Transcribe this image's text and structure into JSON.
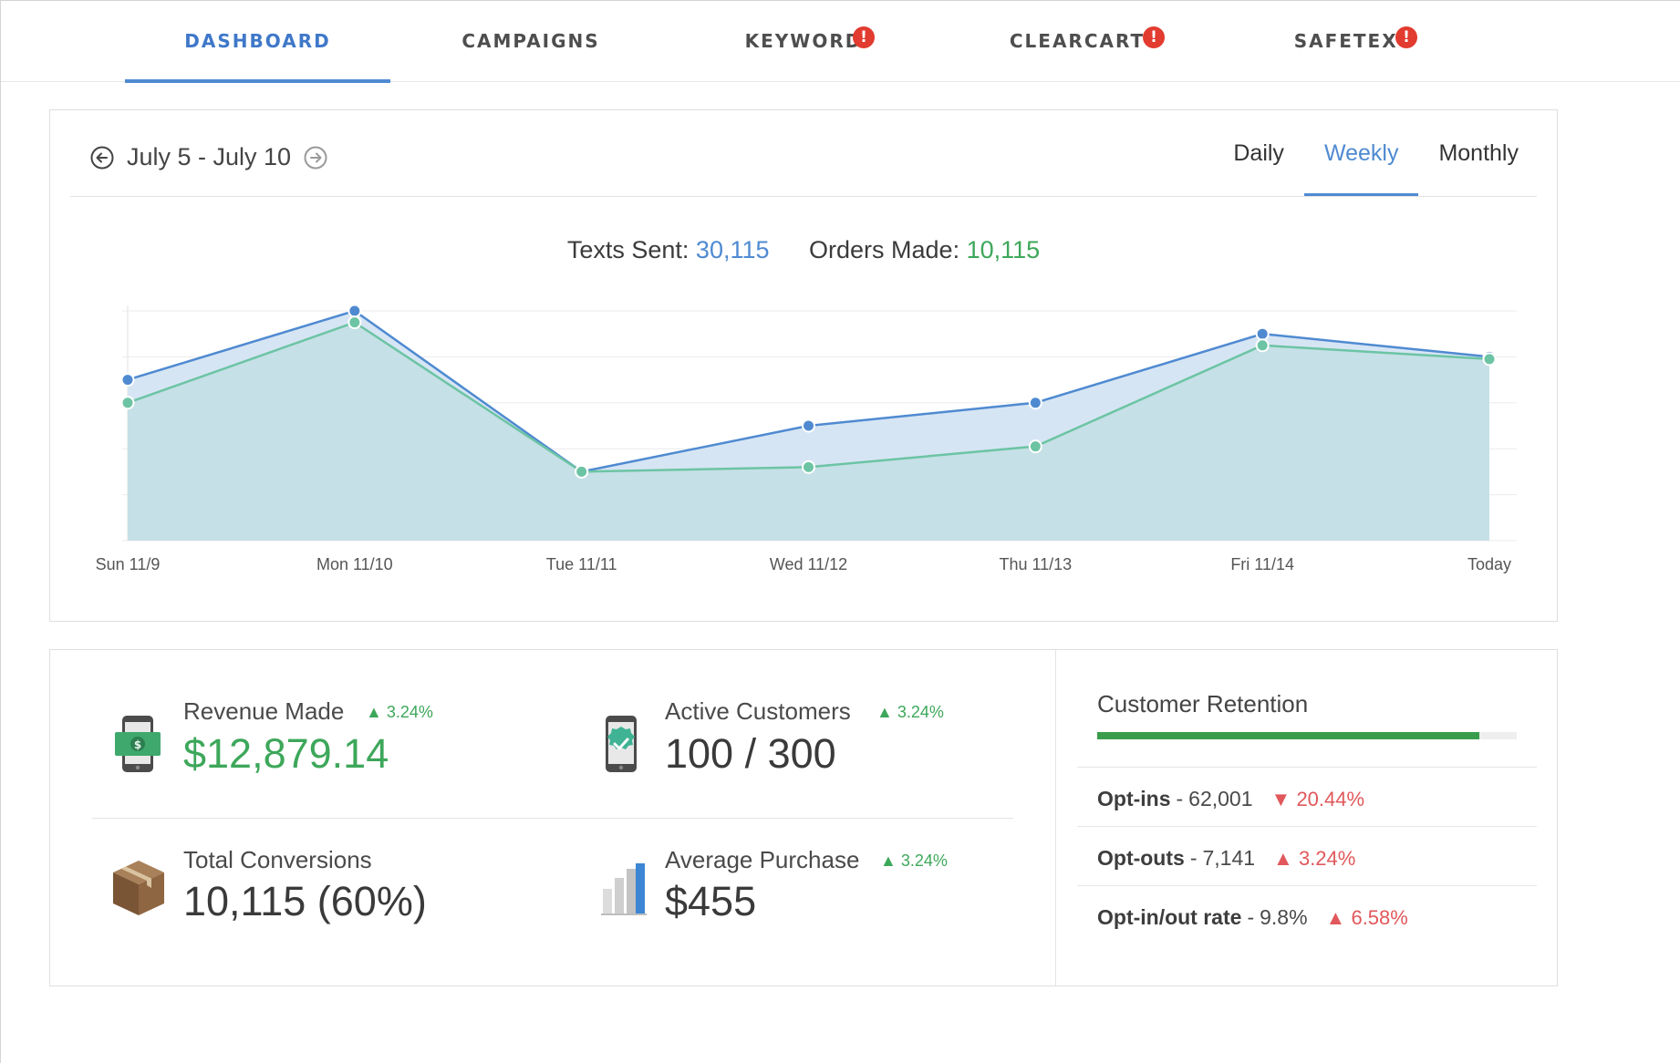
{
  "nav": {
    "tabs": [
      {
        "label": "DASHBOARD",
        "active": true,
        "alert": false
      },
      {
        "label": "CAMPAIGNS",
        "active": false,
        "alert": false
      },
      {
        "label": "KEYWORD",
        "active": false,
        "alert": true
      },
      {
        "label": "CLEARCART",
        "active": false,
        "alert": true
      },
      {
        "label": "SAFETEXT",
        "active": false,
        "alert": true
      }
    ],
    "alert_glyph": "!"
  },
  "date_nav": {
    "range": "July 5 - July 10",
    "prev_icon": "arrow-left-circle-icon",
    "next_icon": "arrow-right-circle-icon"
  },
  "period_tabs": {
    "daily": "Daily",
    "weekly": "Weekly",
    "monthly": "Monthly",
    "selected": "Weekly"
  },
  "summary": {
    "texts_label": "Texts Sent:",
    "texts_value": "30,115",
    "orders_label": "Orders Made:",
    "orders_value": "10,115"
  },
  "chart_data": {
    "type": "area",
    "categories": [
      "Sun 11/9",
      "Mon 11/10",
      "Tue 11/11",
      "Wed 11/12",
      "Thu 11/13",
      "Fri 11/14",
      "Today"
    ],
    "series": [
      {
        "values": [
          70,
          100,
          30,
          50,
          60,
          90,
          80
        ],
        "color": "#4f8ad1"
      },
      {
        "values": [
          60,
          95,
          30,
          32,
          41,
          85,
          79
        ],
        "color": "#6cc4a4"
      }
    ],
    "ylim": [
      0,
      100
    ],
    "grid": true,
    "y_tick_labels_shown": false
  },
  "stats": {
    "revenue": {
      "label": "Revenue Made",
      "change": "3.24%",
      "value": "$12,879.14",
      "icon": "phone-cash-icon"
    },
    "active": {
      "label": "Active Customers",
      "change": "3.24%",
      "value": "100 / 300",
      "icon": "phone-check-badge-icon"
    },
    "conversions": {
      "label": "Total Conversions",
      "value": "10,115 (60%)",
      "icon": "package-box-icon"
    },
    "average": {
      "label": "Average Purchase",
      "change": "3.24%",
      "value": "$455",
      "icon": "bar-chart-icon"
    }
  },
  "retention": {
    "title": "Customer Retention",
    "level": 0.91,
    "rows": [
      {
        "label": "Opt-ins",
        "value": "62,001",
        "change": "20.44%",
        "direction": "down"
      },
      {
        "label": "Opt-outs",
        "value": "7,141",
        "change": "3.24%",
        "direction": "up"
      },
      {
        "label": "Opt-in/out rate",
        "value": "9.8%",
        "change": "6.58%",
        "direction": "up"
      }
    ],
    "separator": "-"
  },
  "colors": {
    "accent_blue": "#4f8ad1",
    "positive_green": "#3da75a",
    "negative_red": "#e0585b",
    "alert_red": "#e23b2f"
  }
}
